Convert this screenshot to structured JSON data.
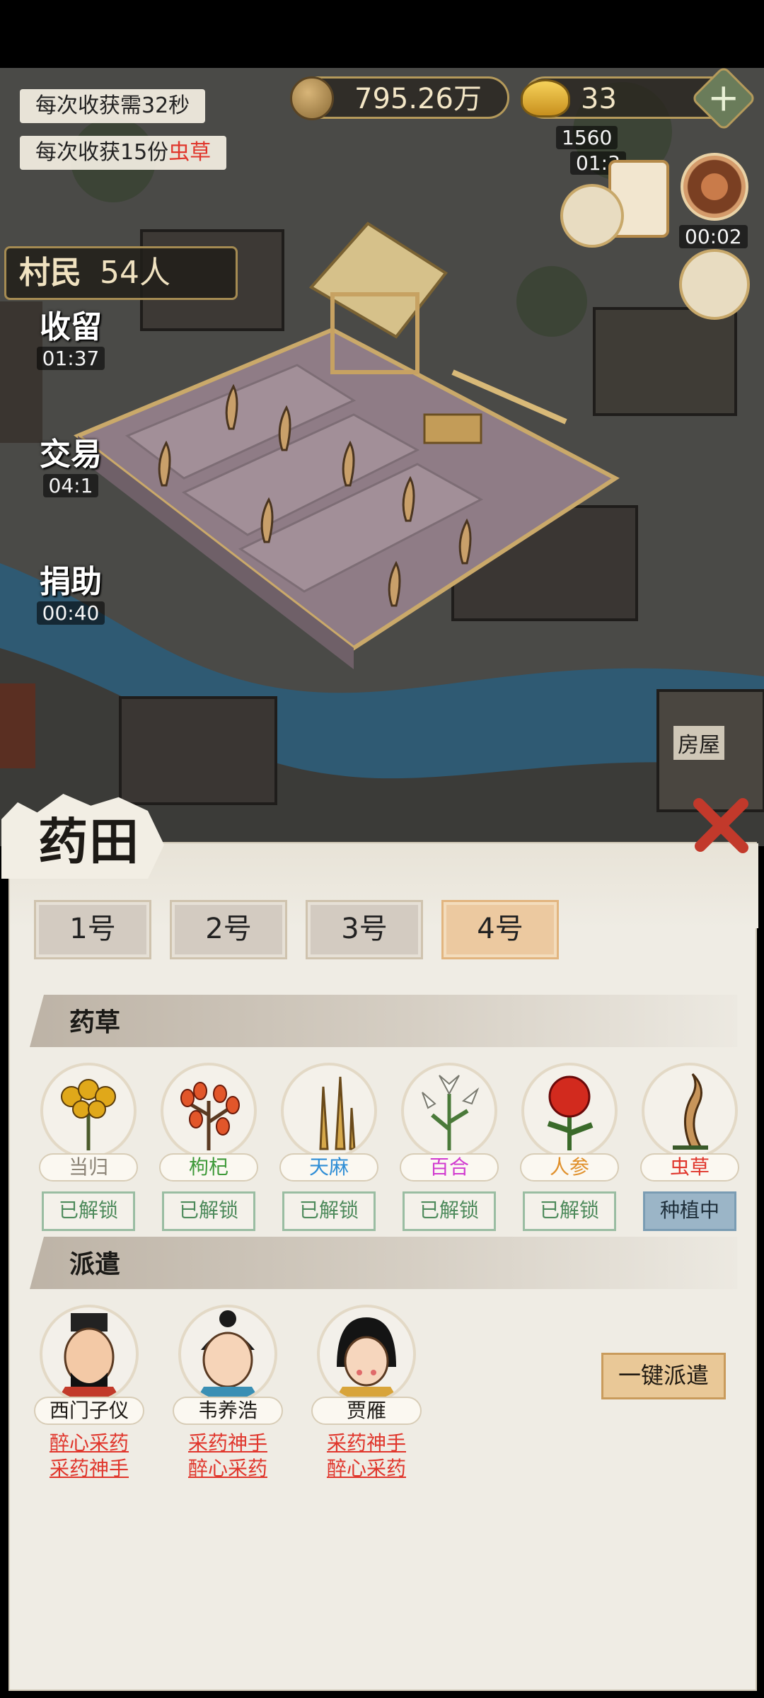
{
  "hud": {
    "harvest_time": "每次收获需32秒",
    "harvest_amount_prefix": "每次收获15份",
    "harvest_amount_item": "虫草",
    "copper": "795.26万",
    "gold": "33",
    "add_icon": "plus-icon",
    "villager_label": "村民",
    "villager_count": "54人"
  },
  "side_actions": [
    {
      "label": "收留",
      "timer": "01:37"
    },
    {
      "label": "交易",
      "timer": "04:1"
    },
    {
      "label": "捐助",
      "timer": "00:40"
    }
  ],
  "right_hud": {
    "timer": "00:02",
    "badge": "1560",
    "badge_timer": "01:3"
  },
  "map_label": "房屋",
  "panel": {
    "title": "药田",
    "close_icon": "close-x-icon",
    "tabs": [
      {
        "label": "1号",
        "active": false
      },
      {
        "label": "2号",
        "active": false
      },
      {
        "label": "3号",
        "active": false
      },
      {
        "label": "4号",
        "active": true
      }
    ],
    "herbs_section": "药草",
    "herbs": [
      {
        "name": "当归",
        "color": "#8c8477",
        "state": "已解锁",
        "icon": "danggui-icon"
      },
      {
        "name": "枸杞",
        "color": "#3f9a3a",
        "state": "已解锁",
        "icon": "goji-icon"
      },
      {
        "name": "天麻",
        "color": "#2f8ed6",
        "state": "已解锁",
        "icon": "tianma-icon"
      },
      {
        "name": "百合",
        "color": "#d13bd0",
        "state": "已解锁",
        "icon": "lily-icon"
      },
      {
        "name": "人参",
        "color": "#e0902b",
        "state": "已解锁",
        "icon": "ginseng-icon"
      },
      {
        "name": "虫草",
        "color": "#e0362c",
        "state": "种植中",
        "icon": "cordyceps-icon"
      }
    ],
    "dispatch_section": "派遣",
    "workers": [
      {
        "name": "西门子仪",
        "skills": [
          "醉心采药",
          "采药神手"
        ]
      },
      {
        "name": "韦养浩",
        "skills": [
          "采药神手",
          "醉心采药"
        ]
      },
      {
        "name": "贾雁",
        "skills": [
          "采药神手",
          "醉心采药"
        ]
      }
    ],
    "dispatch_all": "一键派遣"
  }
}
